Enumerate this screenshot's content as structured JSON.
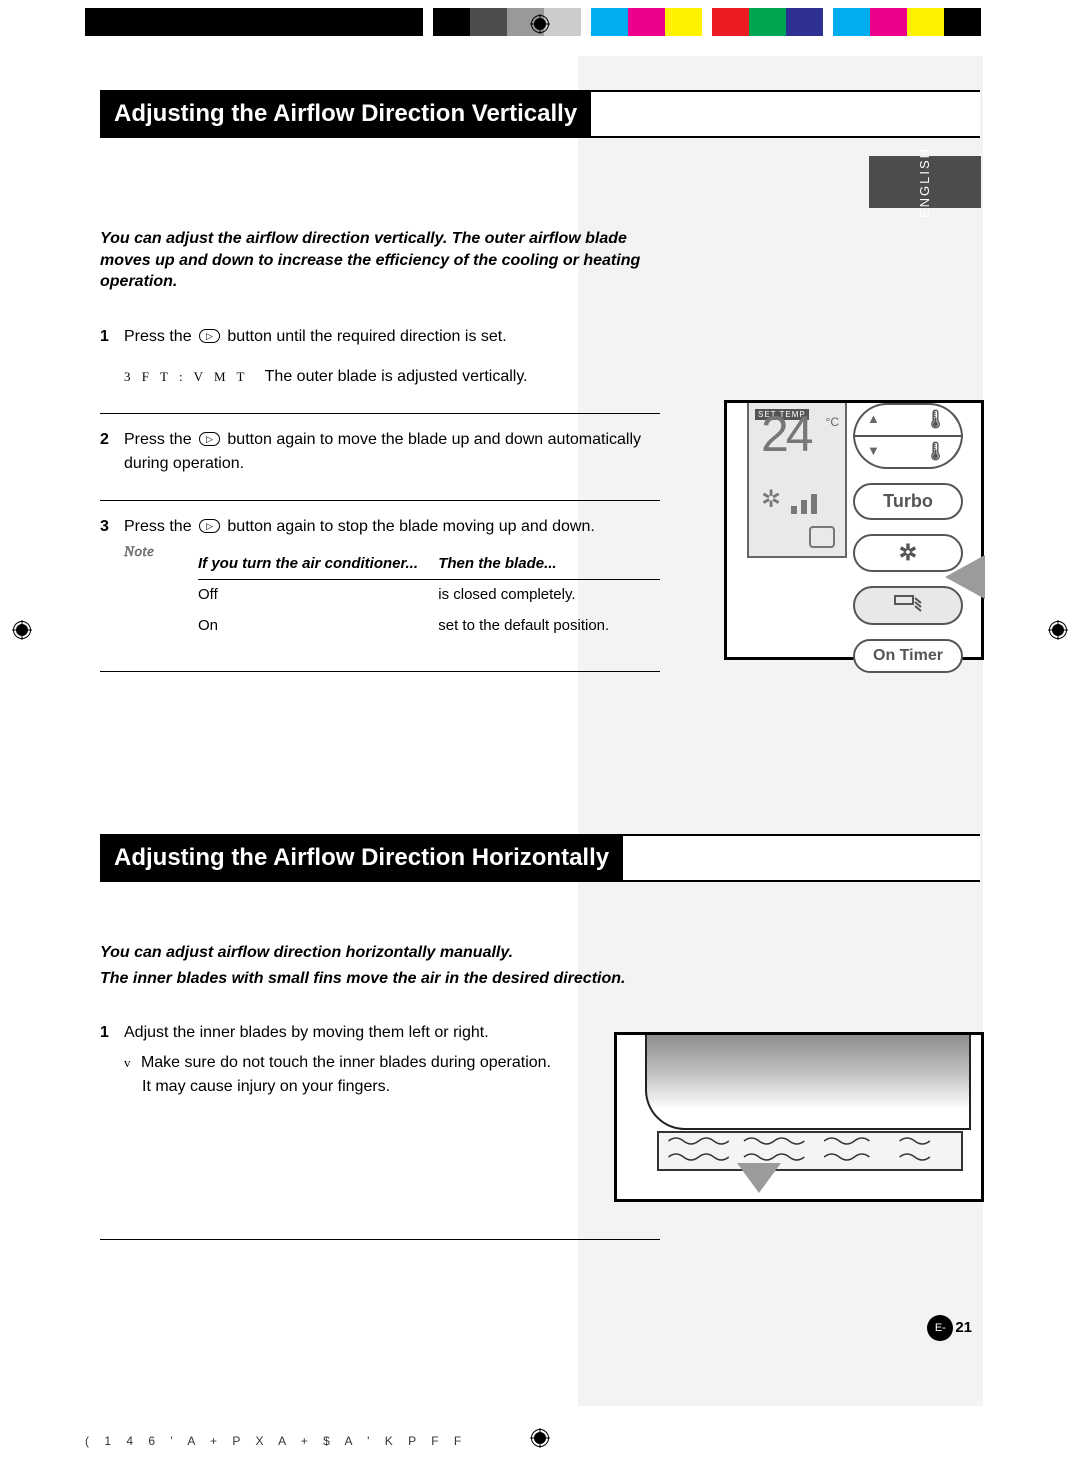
{
  "language_tab": "ENGLISH",
  "section1": {
    "heading": "Adjusting the Airflow Direction Vertically",
    "intro": "You can adjust the airflow direction vertically. The outer airflow blade moves up and down to increase the efficiency of the cooling or heating operation.",
    "steps": {
      "s1_a": "Press the ",
      "s1_b": " button until the required direction is set.",
      "s1_result_label": "3 F T : V M T",
      "s1_result_text": "The outer blade is adjusted vertically.",
      "s2_a": "Press the ",
      "s2_b": " button again to move the blade up and down automatically during operation.",
      "s3_a": "Press the ",
      "s3_b": " button again to stop the blade moving up and down."
    },
    "note_label": "Note",
    "note_table": {
      "h1": "If you turn the air conditioner...",
      "h2": "Then the blade...",
      "r1c1": "Off",
      "r1c2": "is closed completely.",
      "r2c1": "On",
      "r2c2": "set to the default position."
    }
  },
  "section2": {
    "heading": "Adjusting the Airflow Direction Horizontally",
    "intro_l1": "You can adjust airflow direction horizontally manually.",
    "intro_l2": "The inner blades with small fins move the air in the desired direction.",
    "step1": "Adjust the inner blades by moving them left or right.",
    "warn_l1": "Make sure do not touch the inner blades during operation.",
    "warn_l2": "It may cause injury on your fingers."
  },
  "remote": {
    "set_temp_label": "SET TEMP",
    "temp_value": "24",
    "temp_unit": "°C",
    "btn_turbo": "Turbo",
    "btn_ontimer": "On Timer"
  },
  "page_number_prefix": "E-",
  "page_number": "21",
  "footer_code": "( 1 4 6 ' A + P X A + $ A '   K P F F",
  "button_glyph": "▷"
}
